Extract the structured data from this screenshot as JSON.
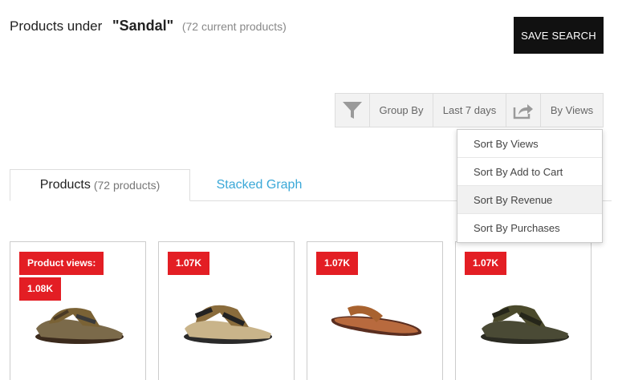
{
  "header": {
    "prefix": "Products under",
    "query": "\"Sandal\"",
    "count": "(72 current products)"
  },
  "save_button": "SAVE SEARCH",
  "toolbar": {
    "group_by": "Group By",
    "date_range": "Last 7 days",
    "sort": "By Views"
  },
  "sort_menu": [
    "Sort By Views",
    "Sort By Add to Cart",
    "Sort By Revenue",
    "Sort By Purchases"
  ],
  "tabs": {
    "products_label": "Products",
    "products_count": "(72 products)",
    "graph_label": "Stacked Graph"
  },
  "products": [
    {
      "badge_label": "Product views:",
      "badge_value": "1.08K",
      "image": "brown-sport-sandal"
    },
    {
      "badge_value": "1.07K",
      "image": "black-tan-sport-sandal"
    },
    {
      "badge_value": "1.07K",
      "image": "brown-leather-flip-flop"
    },
    {
      "badge_value": "1.07K",
      "image": "olive-sport-sandal"
    }
  ],
  "colors": {
    "badge": "#e31e24",
    "tab_link": "#3aa8d8",
    "save_button": "#111111"
  }
}
